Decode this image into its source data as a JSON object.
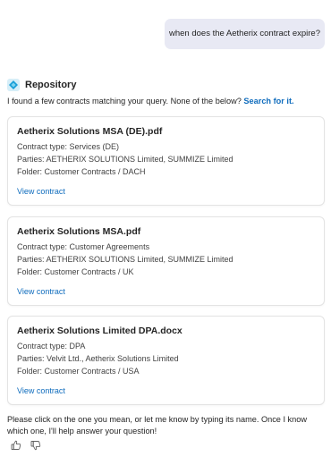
{
  "user_message": "when does the Aetherix contract expire?",
  "bot": {
    "name": "Repository",
    "icon": "diamond-logo-icon",
    "intro_text": "I found a few contracts matching your query. None of the below?",
    "search_link": "Search for it."
  },
  "contracts": [
    {
      "title": "Aetherix Solutions MSA (DE).pdf",
      "type": "Contract type: Services (DE)",
      "parties": "Parties: AETHERIX SOLUTIONS Limited, SUMMIZE Limited",
      "folder": "Folder: Customer Contracts / DACH",
      "view_label": "View contract"
    },
    {
      "title": "Aetherix Solutions MSA.pdf",
      "type": "Contract type: Customer Agreements",
      "parties": "Parties: AETHERIX SOLUTIONS Limited, SUMMIZE Limited",
      "folder": "Folder: Customer Contracts / UK",
      "view_label": "View contract"
    },
    {
      "title": "Aetherix Solutions Limited DPA.docx",
      "type": "Contract type: DPA",
      "parties": "Parties: Velvit Ltd., Aetherix Solutions Limited",
      "folder": "Folder: Customer Contracts / USA",
      "view_label": "View contract"
    }
  ],
  "footer_text": "Please click on the one you mean, or let me know by typing its name. Once I know which one, I'll help answer your question!",
  "feedback": {
    "like_icon": "thumbs-up-icon",
    "dislike_icon": "thumbs-down-icon"
  },
  "colors": {
    "accent": "#0f6cbd",
    "user_bubble": "#e8e9f4",
    "card_border": "#e3e3e3"
  }
}
